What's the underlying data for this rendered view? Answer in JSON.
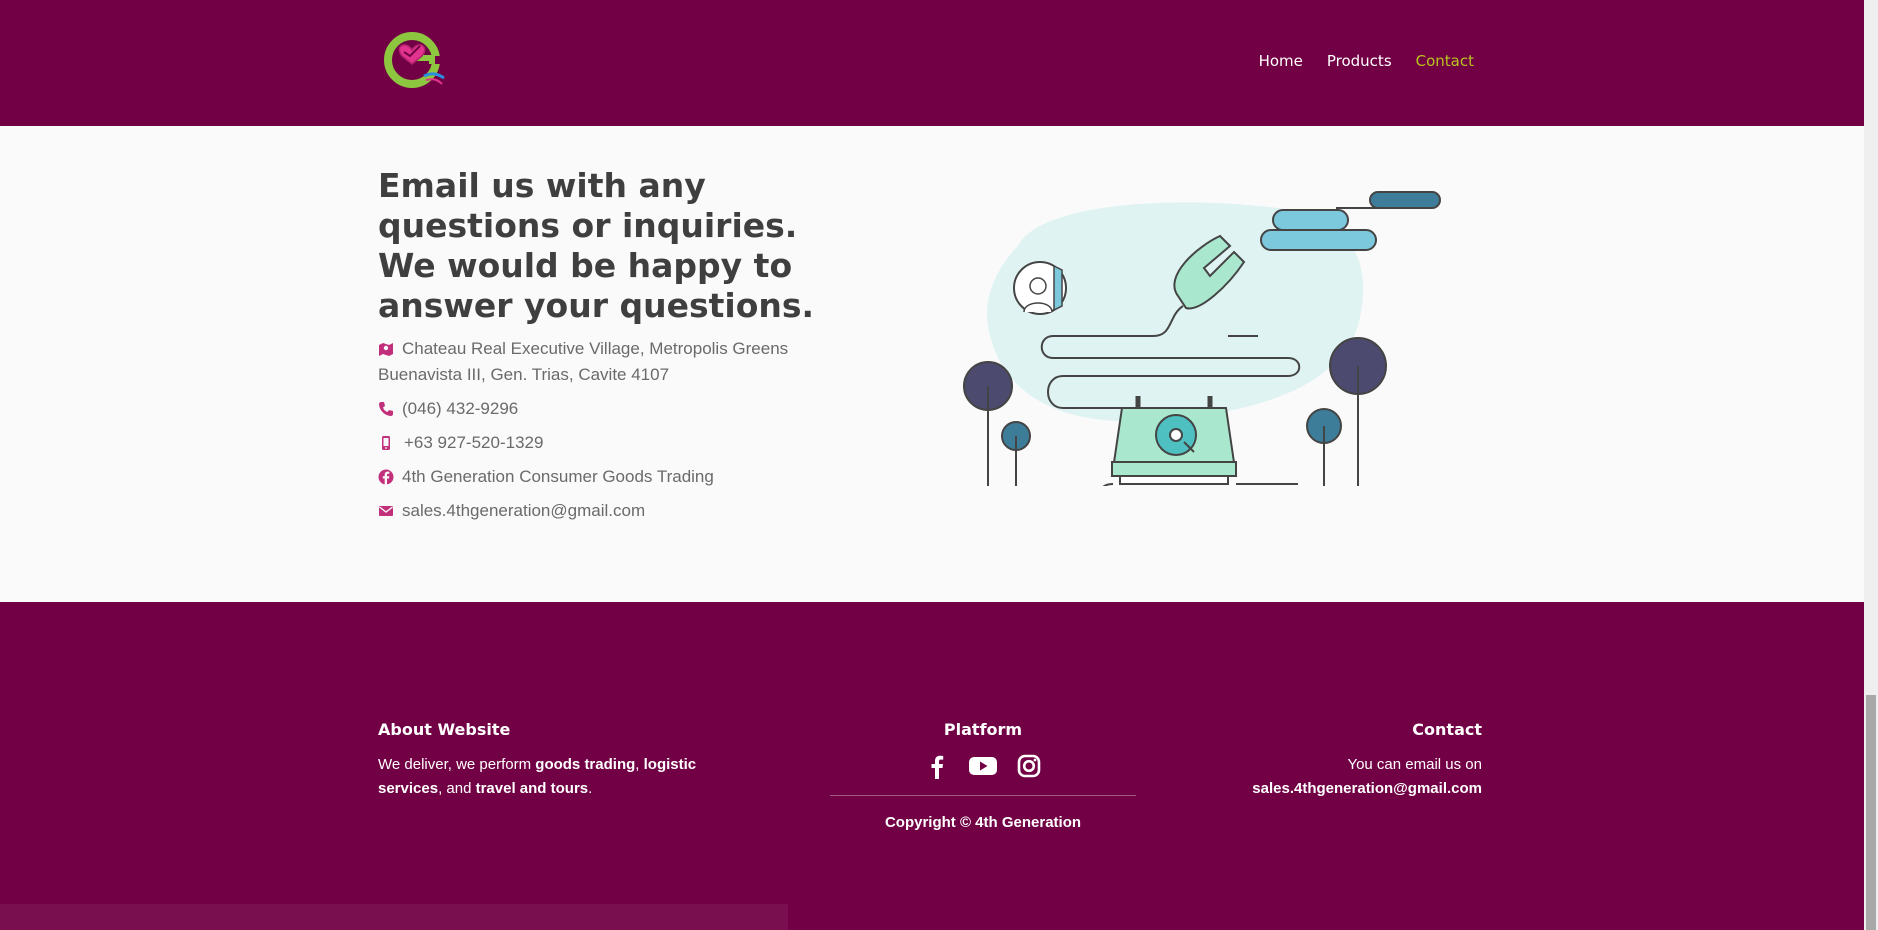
{
  "nav": {
    "items": [
      {
        "label": "Home"
      },
      {
        "label": "Products"
      },
      {
        "label": "Contact"
      }
    ]
  },
  "main": {
    "heading": "Email us with any questions or inquiries. We would be happy to answer your questions.",
    "address_line1": "Chateau Real Executive Village, Metropolis Greens",
    "address_line2": "Buenavista III, Gen. Trias, Cavite 4107",
    "phone": "(046) 432-9296",
    "mobile": "+63 927-520-1329",
    "facebook": "4th Generation Consumer Goods Trading",
    "email": "sales.4thgeneration@gmail.com"
  },
  "footer": {
    "about_title": "About Website",
    "about_pre": "We deliver, we perform ",
    "about_b1": "goods trading",
    "about_sep": ", ",
    "about_b2": "logistic services",
    "about_mid": ", and ",
    "about_b3": "travel and tours",
    "about_end": ".",
    "platform_title": "Platform",
    "copyright": "Copyright © 4th Generation",
    "contact_title": "Contact",
    "contact_text": "You can email us on",
    "contact_email": "sales.4thgeneration@gmail.com"
  },
  "colors": {
    "brand": "#720044",
    "accent_nav": "#b8c41e",
    "icon_pink": "#c2307c",
    "heading": "#3f3f3f"
  },
  "icons": [
    "map-marker-icon",
    "phone-icon",
    "mobile-icon",
    "facebook-icon",
    "envelope-icon",
    "facebook-icon",
    "youtube-icon",
    "instagram-icon"
  ]
}
